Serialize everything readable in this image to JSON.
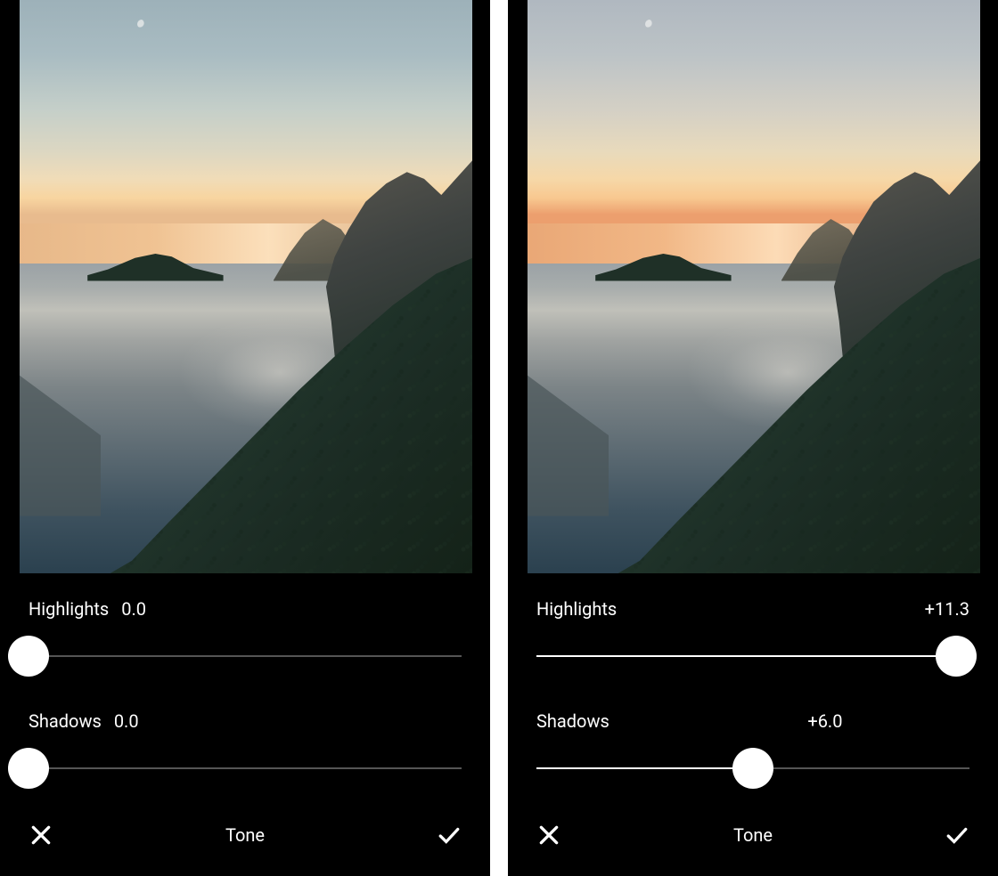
{
  "panels": [
    {
      "highlights": {
        "label": "Highlights",
        "value": "0.0",
        "position_pct": 0,
        "value_align": "left"
      },
      "shadows": {
        "label": "Shadows",
        "value": "0.0",
        "position_pct": 0,
        "value_align": "left"
      },
      "title": "Tone",
      "sky_class": "sky-left"
    },
    {
      "highlights": {
        "label": "Highlights",
        "value": "+11.3",
        "position_pct": 97,
        "value_align": "right"
      },
      "shadows": {
        "label": "Shadows",
        "value": "+6.0",
        "position_pct": 50,
        "value_align": "mid"
      },
      "title": "Tone",
      "sky_class": "sky-right"
    }
  ],
  "icons": {
    "close": "close-icon",
    "confirm": "check-icon"
  }
}
